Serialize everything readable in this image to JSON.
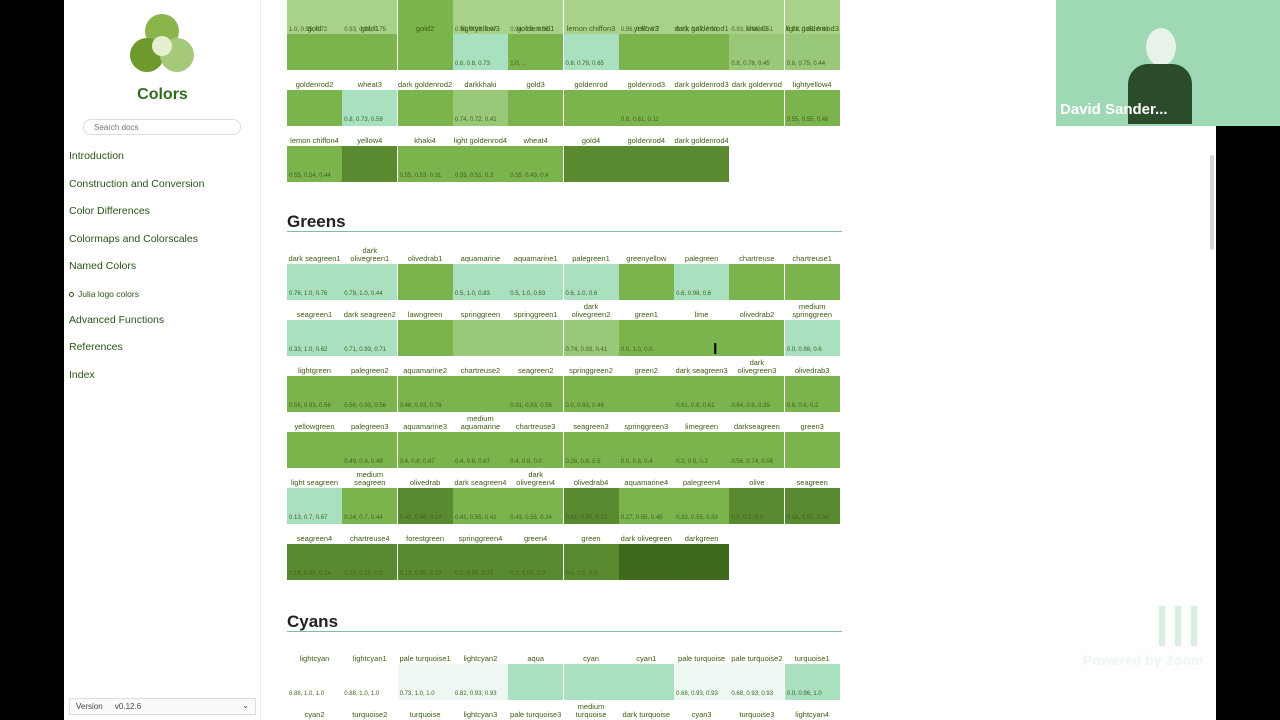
{
  "sidebar": {
    "title": "Colors",
    "search_placeholder": "Search docs",
    "nav": [
      {
        "label": "Introduction"
      },
      {
        "label": "Construction and Conversion"
      },
      {
        "label": "Color Differences"
      },
      {
        "label": "Colormaps and Colorscales"
      },
      {
        "label": "Named Colors"
      },
      {
        "label": "Julia logo colors",
        "sub": true
      },
      {
        "label": "Advanced Functions"
      },
      {
        "label": "References"
      },
      {
        "label": "Index"
      }
    ],
    "version_label": "Version",
    "version_value": "v0.12.6"
  },
  "sections": {
    "greens_title": "Greens",
    "cyans_title": "Cyans"
  },
  "yellow_rows": [
    [
      {
        "name": "",
        "rgb": "1.0, 0.95, 0.72",
        "color": "#a8d28a"
      },
      {
        "name": "",
        "rgb": "0.93, 0.91, 0.75",
        "color": "#a8d28a"
      },
      {
        "name": "",
        "rgb": "",
        "color": "#7bb34d"
      },
      {
        "name": "",
        "rgb": "0.93, 0.93, 0.67",
        "color": "#a8d28a"
      },
      {
        "name": "",
        "rgb": "0.94, 0.9, 0.55",
        "color": "#a8d28a"
      },
      {
        "name": "",
        "rgb": "",
        "color": "#a8d28a"
      },
      {
        "name": "",
        "rgb": "0.96, 0.87, 0.7",
        "color": "#a8d28a"
      },
      {
        "name": "",
        "rgb": "0.93, 0.87, 0.51",
        "color": "#a8d28a"
      },
      {
        "name": "",
        "rgb": "0.93, 0.86, 0.51",
        "color": "#a8d28a"
      },
      {
        "name": "",
        "rgb": "0.93, 0.85, 0.68",
        "color": "#a8d28a"
      }
    ],
    [
      {
        "name": "gold",
        "rgb": "",
        "color": "#7bb34d"
      },
      {
        "name": "gold1",
        "rgb": "",
        "color": "#7bb34d"
      },
      {
        "name": "gold2",
        "rgb": "",
        "color": "#7bb34d"
      },
      {
        "name": "lightyellow3",
        "rgb": "0.8, 0.8, 0.73",
        "color": "#a8e0c0"
      },
      {
        "name": "goldenrod1",
        "rgb": "1.0, ...",
        "color": "#7bb34d"
      },
      {
        "name": "lemon chiffon3",
        "rgb": "0.8, 0.79, 0.65",
        "color": "#a8e0c0"
      },
      {
        "name": "yellow3",
        "rgb": "",
        "color": "#7bb34d"
      },
      {
        "name": "dark goldenrod1",
        "rgb": "",
        "color": "#7bb34d"
      },
      {
        "name": "khaki3",
        "rgb": "0.8, 0.78, 0.45",
        "color": "#98c878"
      },
      {
        "name": "light goldenrod3",
        "rgb": "0.8, 0.75, 0.44",
        "color": "#98c878"
      }
    ],
    [
      {
        "name": "goldenrod2",
        "rgb": "",
        "color": "#7bb34d"
      },
      {
        "name": "wheat3",
        "rgb": "0.8, 0.73, 0.59",
        "color": "#a8e0c0"
      },
      {
        "name": "dark goldenrod2",
        "rgb": "",
        "color": "#7bb34d"
      },
      {
        "name": "darkkhaki",
        "rgb": "0.74, 0.72, 0.42",
        "color": "#98c878"
      },
      {
        "name": "gold3",
        "rgb": "",
        "color": "#7bb34d"
      },
      {
        "name": "goldenrod",
        "rgb": "",
        "color": "#7bb34d"
      },
      {
        "name": "goldenrod3",
        "rgb": "0.8, 0.61, 0.11",
        "color": "#7bb34d"
      },
      {
        "name": "dark goldenrod3",
        "rgb": "",
        "color": "#7bb34d"
      },
      {
        "name": "dark goldenrod",
        "rgb": "",
        "color": "#7bb34d"
      },
      {
        "name": "lightyellow4",
        "rgb": "0.55, 0.55, 0.48",
        "color": "#7bb34d"
      }
    ],
    [
      {
        "name": "lemon chiffon4",
        "rgb": "0.55, 0.54, 0.44",
        "color": "#7bb34d"
      },
      {
        "name": "yellow4",
        "rgb": "",
        "color": "#5a8a30"
      },
      {
        "name": "khaki4",
        "rgb": "0.55, 0.53, 0.31",
        "color": "#7bb34d"
      },
      {
        "name": "light goldenrod4",
        "rgb": "0.55, 0.51, 0.3",
        "color": "#7bb34d"
      },
      {
        "name": "wheat4",
        "rgb": "0.55, 0.49, 0.4",
        "color": "#7bb34d"
      },
      {
        "name": "gold4",
        "rgb": "",
        "color": "#5a8a30"
      },
      {
        "name": "goldenrod4",
        "rgb": "",
        "color": "#5a8a30"
      },
      {
        "name": "dark goldenrod4",
        "rgb": "",
        "color": "#5a8a30"
      }
    ]
  ],
  "green_rows": [
    [
      {
        "name": "dark seagreen1",
        "rgb": "0.76, 1.0, 0.76",
        "color": "#a8e0c0"
      },
      {
        "name": "dark olivegreen1",
        "rgb": "0.79, 1.0, 0.44",
        "color": "#a8e0c0"
      },
      {
        "name": "olivedrab1",
        "rgb": "",
        "color": "#7bb34d"
      },
      {
        "name": "aquamarine",
        "rgb": "0.5, 1.0, 0.83",
        "color": "#a8e0c0"
      },
      {
        "name": "aquamarine1",
        "rgb": "0.5, 1.0, 0.83",
        "color": "#a8e0c0"
      },
      {
        "name": "palegreen1",
        "rgb": "0.6, 1.0, 0.6",
        "color": "#a8e0c0"
      },
      {
        "name": "greenyellow",
        "rgb": "",
        "color": "#7bb34d"
      },
      {
        "name": "palegreen",
        "rgb": "0.6, 0.98, 0.6",
        "color": "#a8e0c0"
      },
      {
        "name": "chartreuse",
        "rgb": "",
        "color": "#7bb34d"
      },
      {
        "name": "chartreuse1",
        "rgb": "",
        "color": "#7bb34d"
      }
    ],
    [
      {
        "name": "seagreen1",
        "rgb": "0.33, 1.0, 0.62",
        "color": "#a8e0c0"
      },
      {
        "name": "dark seagreen2",
        "rgb": "0.71, 0.93, 0.71",
        "color": "#a8e0c0"
      },
      {
        "name": "lawngreen",
        "rgb": "",
        "color": "#7bb34d"
      },
      {
        "name": "springgreen",
        "rgb": "",
        "color": "#98c878"
      },
      {
        "name": "springgreen1",
        "rgb": "",
        "color": "#98c878"
      },
      {
        "name": "dark olivegreen2",
        "rgb": "0.74, 0.93, 0.41",
        "color": "#98c878"
      },
      {
        "name": "green1",
        "rgb": "0.0, 1.0, 0.0",
        "color": "#7bb34d"
      },
      {
        "name": "lime",
        "rgb": "",
        "color": "#7bb34d"
      },
      {
        "name": "olivedrab2",
        "rgb": "",
        "color": "#7bb34d"
      },
      {
        "name": "medium springgreen",
        "rgb": "0.0, 0.98, 0.6",
        "color": "#a8e0c0"
      }
    ],
    [
      {
        "name": "lightgreen",
        "rgb": "0.56, 0.93, 0.56",
        "color": "#7bb34d"
      },
      {
        "name": "palegreen2",
        "rgb": "0.56, 0.93, 0.56",
        "color": "#7bb34d"
      },
      {
        "name": "aquamarine2",
        "rgb": "0.46, 0.93, 0.78",
        "color": "#7bb34d"
      },
      {
        "name": "chartreuse2",
        "rgb": "",
        "color": "#7bb34d"
      },
      {
        "name": "seagreen2",
        "rgb": "0.31, 0.93, 0.58",
        "color": "#7bb34d"
      },
      {
        "name": "springgreen2",
        "rgb": "0.0, 0.93, 0.46",
        "color": "#7bb34d"
      },
      {
        "name": "green2",
        "rgb": "",
        "color": "#7bb34d"
      },
      {
        "name": "dark seagreen3",
        "rgb": "0.61, 0.8, 0.61",
        "color": "#7bb34d"
      },
      {
        "name": "dark olivegreen3",
        "rgb": "0.64, 0.8, 0.35",
        "color": "#7bb34d"
      },
      {
        "name": "olivedrab3",
        "rgb": "0.6, 0.8, 0.2",
        "color": "#7bb34d"
      }
    ],
    [
      {
        "name": "yellowgreen",
        "rgb": "",
        "color": "#7bb34d"
      },
      {
        "name": "palegreen3",
        "rgb": "0.49, 0.8, 0.49",
        "color": "#7bb34d"
      },
      {
        "name": "aquamarine3",
        "rgb": "0.4, 0.8, 0.67",
        "color": "#7bb34d"
      },
      {
        "name": "medium aquamarine",
        "rgb": "0.4, 0.8, 0.67",
        "color": "#7bb34d"
      },
      {
        "name": "chartreuse3",
        "rgb": "0.4, 0.8, 0.0",
        "color": "#7bb34d"
      },
      {
        "name": "seagreen3",
        "rgb": "0.26, 0.8, 0.5",
        "color": "#7bb34d"
      },
      {
        "name": "springgreen3",
        "rgb": "0.0, 0.8, 0.4",
        "color": "#7bb34d"
      },
      {
        "name": "limegreen",
        "rgb": "0.2, 0.8, 0.2",
        "color": "#7bb34d"
      },
      {
        "name": "darkseagreen",
        "rgb": "0.56, 0.74, 0.56",
        "color": "#7bb34d"
      },
      {
        "name": "green3",
        "rgb": "",
        "color": "#7bb34d"
      }
    ],
    [
      {
        "name": "light seagreen",
        "rgb": "0.13, 0.7, 0.67",
        "color": "#a8e0c0"
      },
      {
        "name": "medium seagreen",
        "rgb": "0.24, 0.7, 0.44",
        "color": "#7bb34d"
      },
      {
        "name": "olivedrab",
        "rgb": "0.42, 0.56, 0.14",
        "color": "#5a8a30"
      },
      {
        "name": "dark seagreen4",
        "rgb": "0.41, 0.55, 0.41",
        "color": "#7bb34d"
      },
      {
        "name": "dark olivegreen4",
        "rgb": "0.43, 0.55, 0.24",
        "color": "#7bb34d"
      },
      {
        "name": "olivedrab4",
        "rgb": "0.41, 0.55, 0.13",
        "color": "#5a8a30"
      },
      {
        "name": "aquamarine4",
        "rgb": "0.27, 0.55, 0.45",
        "color": "#7bb34d"
      },
      {
        "name": "palegreen4",
        "rgb": "0.33, 0.55, 0.33",
        "color": "#7bb34d"
      },
      {
        "name": "olive",
        "rgb": "0.5, 0.5, 0.0",
        "color": "#5a8a30"
      },
      {
        "name": "seagreen",
        "rgb": "0.18, 0.55, 0.34",
        "color": "#5a8a30"
      }
    ],
    [
      {
        "name": "seagreen4",
        "rgb": "0.18, 0.55, 0.34",
        "color": "#5a8a30"
      },
      {
        "name": "chartreuse4",
        "rgb": "0.27, 0.55, 0.0",
        "color": "#5a8a30"
      },
      {
        "name": "forestgreen",
        "rgb": "0.13, 0.55, 0.13",
        "color": "#5a8a30"
      },
      {
        "name": "springgreen4",
        "rgb": "0.0, 0.55, 0.27",
        "color": "#5a8a30"
      },
      {
        "name": "green4",
        "rgb": "0.0, 0.55, 0.0",
        "color": "#5a8a30"
      },
      {
        "name": "green",
        "rgb": "0.0, 0.5, 0.0",
        "color": "#5a8a30"
      },
      {
        "name": "dark olivegreen",
        "rgb": "0.33, 0.42, 0.18",
        "color": "#3f6a1e"
      },
      {
        "name": "darkgreen",
        "rgb": "0.0, 0.39, 0.0",
        "color": "#3f6a1e"
      }
    ]
  ],
  "cyan_rows": [
    [
      {
        "name": "lightcyan",
        "rgb": "0.88, 1.0, 1.0",
        "color": "#ffffff"
      },
      {
        "name": "lightcyan1",
        "rgb": "0.88, 1.0, 1.0",
        "color": "#ffffff"
      },
      {
        "name": "pale turquoise1",
        "rgb": "0.73, 1.0, 1.0",
        "color": "#eef8f2"
      },
      {
        "name": "lightcyan2",
        "rgb": "0.82, 0.93, 0.93",
        "color": "#eef8f2"
      },
      {
        "name": "aqua",
        "rgb": "",
        "color": "#a8e0c0"
      },
      {
        "name": "cyan",
        "rgb": "",
        "color": "#a8e0c0"
      },
      {
        "name": "cyan1",
        "rgb": "",
        "color": "#a8e0c0"
      },
      {
        "name": "pale turquoise",
        "rgb": "0.69, 0.93, 0.93",
        "color": "#eef8f2"
      },
      {
        "name": "pale turquoise2",
        "rgb": "0.68, 0.93, 0.93",
        "color": "#eef8f2"
      },
      {
        "name": "turquoise1",
        "rgb": "0.0, 0.96, 1.0",
        "color": "#a8e0c0"
      }
    ],
    [
      {
        "name": "cyan2",
        "rgb": "",
        "color": "#a8e0c0"
      },
      {
        "name": "turquoise2",
        "rgb": "",
        "color": "#a8e0c0"
      },
      {
        "name": "turquoise",
        "rgb": "",
        "color": "#a8e0c0"
      },
      {
        "name": "lightcyan3",
        "rgb": "",
        "color": "#a8e0c0"
      },
      {
        "name": "pale turquoise3",
        "rgb": "",
        "color": "#a8e0c0"
      },
      {
        "name": "medium turquoise",
        "rgb": "",
        "color": "#a8e0c0"
      },
      {
        "name": "dark turquoise",
        "rgb": "",
        "color": "#a8e0c0"
      },
      {
        "name": "cyan3",
        "rgb": "",
        "color": "#a8e0c0"
      },
      {
        "name": "turquoise3",
        "rgb": "",
        "color": "#a8e0c0"
      },
      {
        "name": "lightcyan4",
        "rgb": "",
        "color": "#a8e0c0"
      }
    ]
  ],
  "video": {
    "participant_name": "David Sander..."
  },
  "watermark": {
    "text": "Powered by Zoom"
  }
}
